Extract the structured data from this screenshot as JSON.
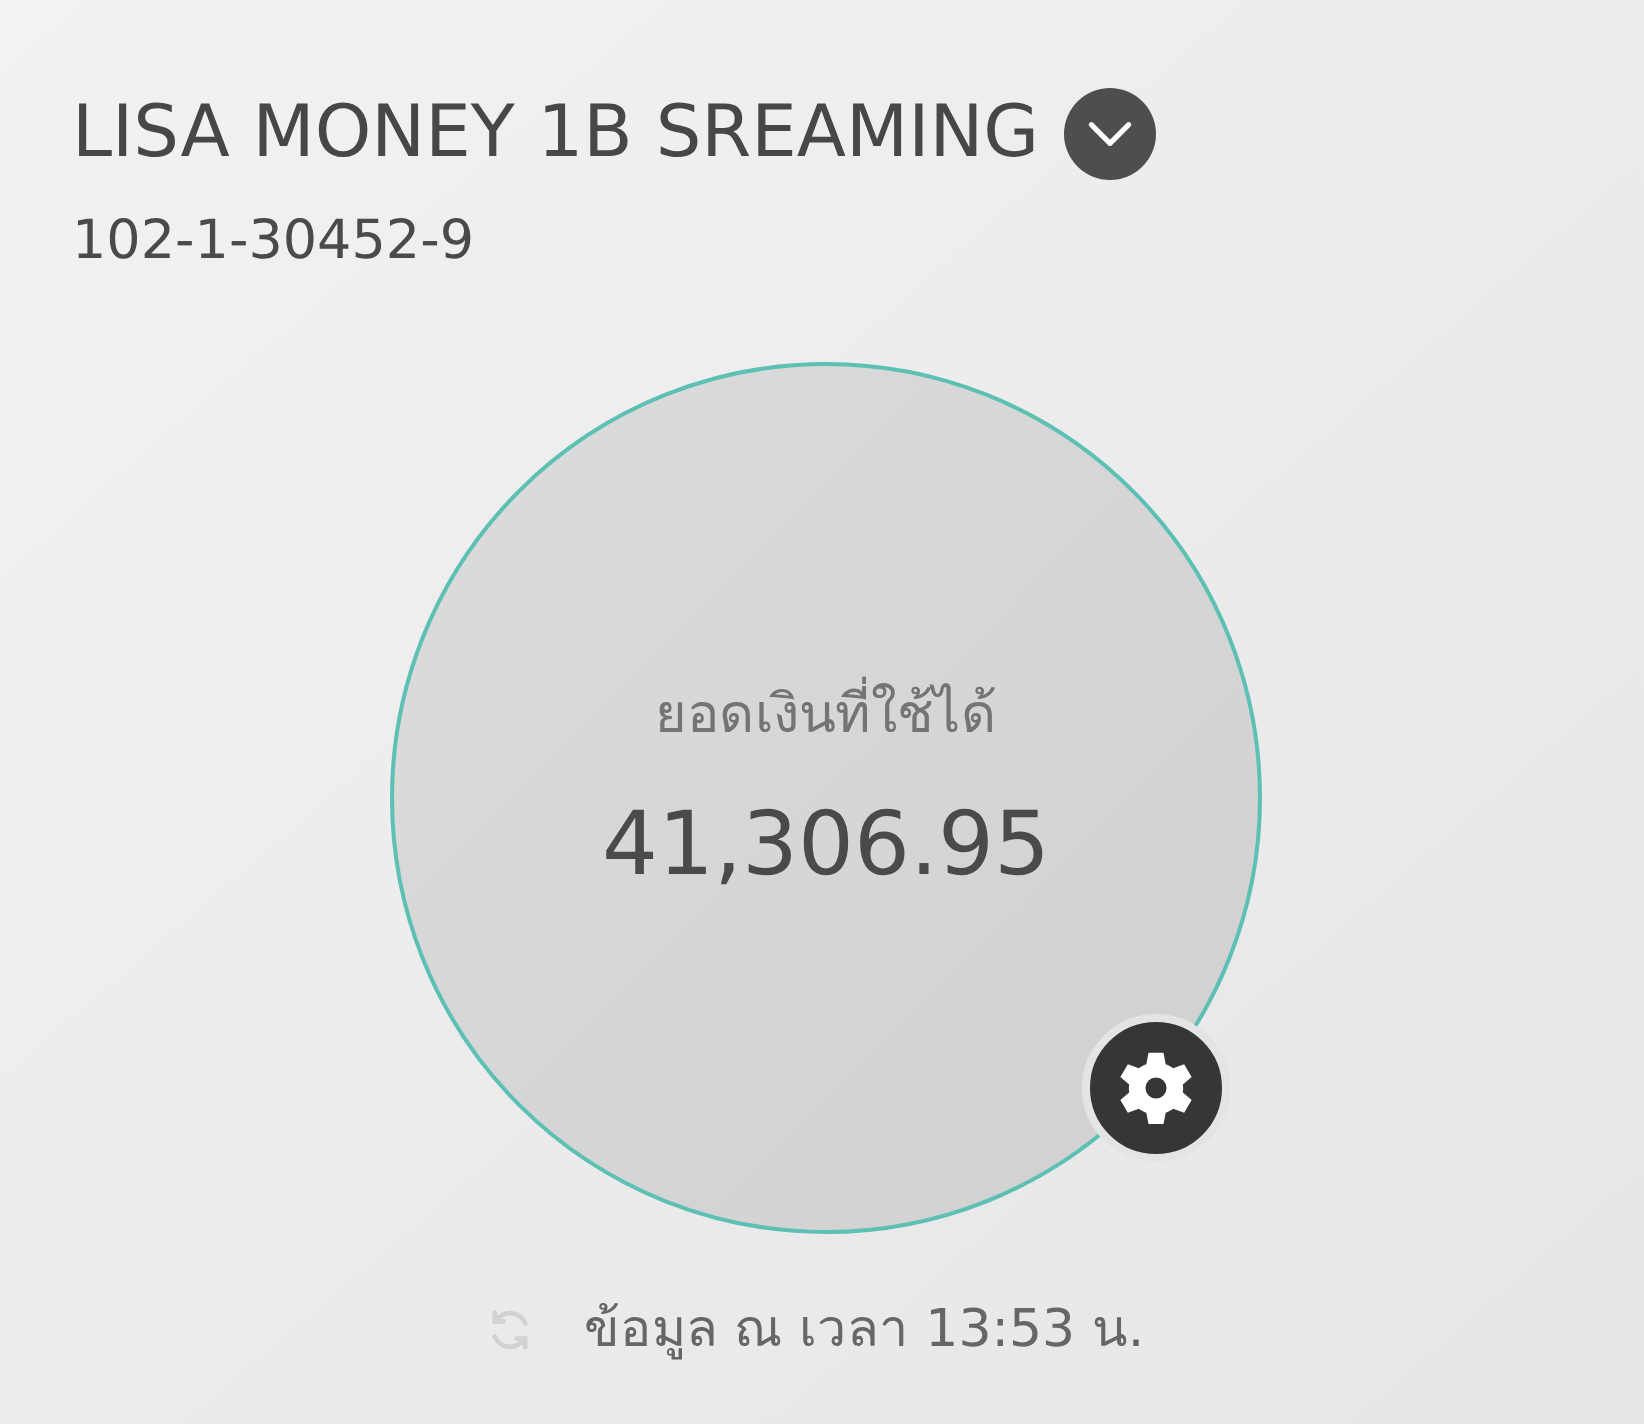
{
  "account": {
    "name": "LISA MONEY 1B SREAMING",
    "number": "102-1-30452-9"
  },
  "balance": {
    "label": "ยอดเงินที่ใช้ได้",
    "amount": "41,306.95"
  },
  "footer": {
    "updated": "ข้อมูล ณ เวลา 13:53 น."
  }
}
